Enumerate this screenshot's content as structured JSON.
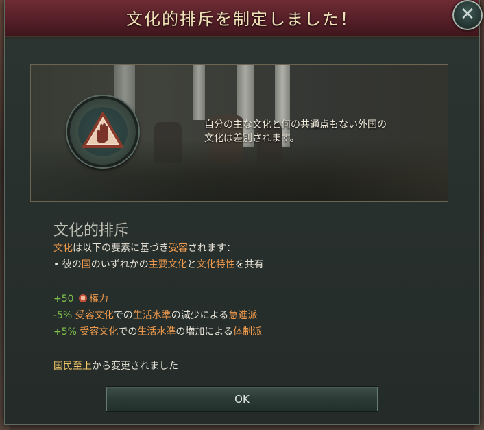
{
  "dialog": {
    "title": "文化的排斥を制定しました！",
    "close_icon": "close-x-icon"
  },
  "illustration": {
    "description_line1": "自分の主な文化と何の共通点もない外国の",
    "description_line2": "文化は差別されます。",
    "emblem_icon": "raised-hand-warning-icon"
  },
  "law": {
    "name": "文化的排斥",
    "accept_prefix_hl": "文化",
    "accept_mid": "は以下の要素に基づき",
    "accept_hl2": "受容",
    "accept_suffix": "されます：",
    "bullet_prefix": "• 彼の",
    "bullet_hl1": "国",
    "bullet_mid1": "のいずれかの",
    "bullet_hl2": "主要文化",
    "bullet_mid2": "と",
    "bullet_hl3": "文化特性",
    "bullet_suffix": "を共有"
  },
  "effects": [
    {
      "value": "+50",
      "icon": "power-fist-icon",
      "label_hl": "権力"
    },
    {
      "value": "-5%",
      "p1": "受容文化",
      "p2": "での",
      "p3": "生活水準",
      "p4": "の減少による",
      "p5": "急進派"
    },
    {
      "value": "+5%",
      "p1": "受容文化",
      "p2": "での",
      "p3": "生活水準",
      "p4": "の増加による",
      "p5": "体制派"
    }
  ],
  "change": {
    "from_hl": "国民至上",
    "suffix": "から変更されました"
  },
  "buttons": {
    "ok_label": "OK"
  },
  "colors": {
    "header": "#561f28",
    "highlight": "#ef9a4c",
    "positive": "#7fc24a",
    "title_text": "#f0e2b8"
  }
}
